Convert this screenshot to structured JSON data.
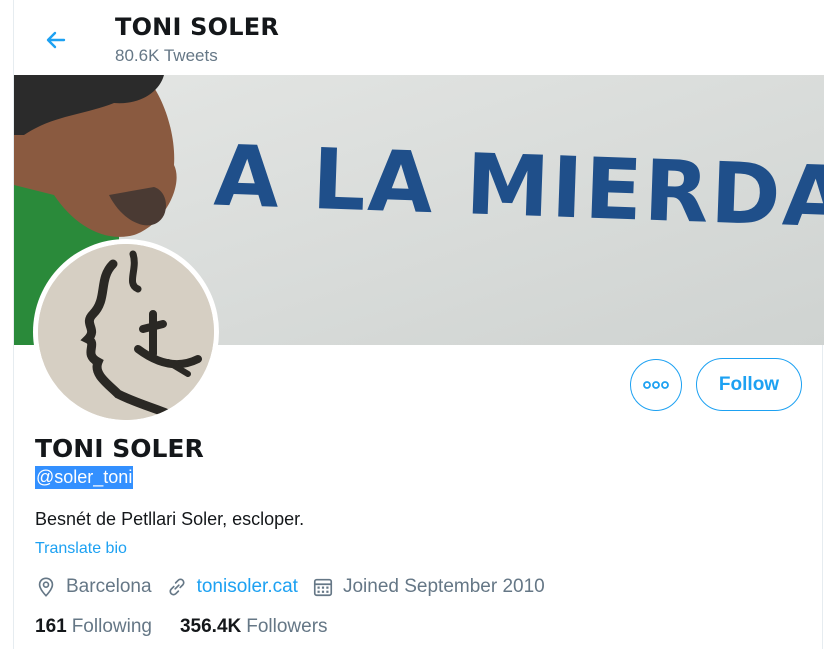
{
  "header": {
    "title": "TONI SOLER",
    "tweet_count": "80.6K Tweets"
  },
  "banner": {
    "graffiti_text": "A LA MIERDA!"
  },
  "actions": {
    "more_label": "•••",
    "follow_label": "Follow"
  },
  "profile": {
    "name": "TONI SOLER",
    "handle": "@soler_toni",
    "bio": "Besnét de Petllari Soler, escloper.",
    "translate_label": "Translate bio",
    "location": "Barcelona",
    "website": "tonisoler.cat",
    "joined": "Joined September 2010"
  },
  "stats": {
    "following_count": "161",
    "following_label": "Following",
    "followers_count": "356.4K",
    "followers_label": "Followers"
  },
  "colors": {
    "accent": "#1da1f2",
    "secondary_text": "#657786",
    "primary_text": "#14171a",
    "selection": "#3390ff"
  },
  "icons": {
    "back": "arrow-left-icon",
    "location": "location-pin-icon",
    "website": "link-icon",
    "joined": "calendar-icon",
    "more": "more-horizontal-icon"
  }
}
